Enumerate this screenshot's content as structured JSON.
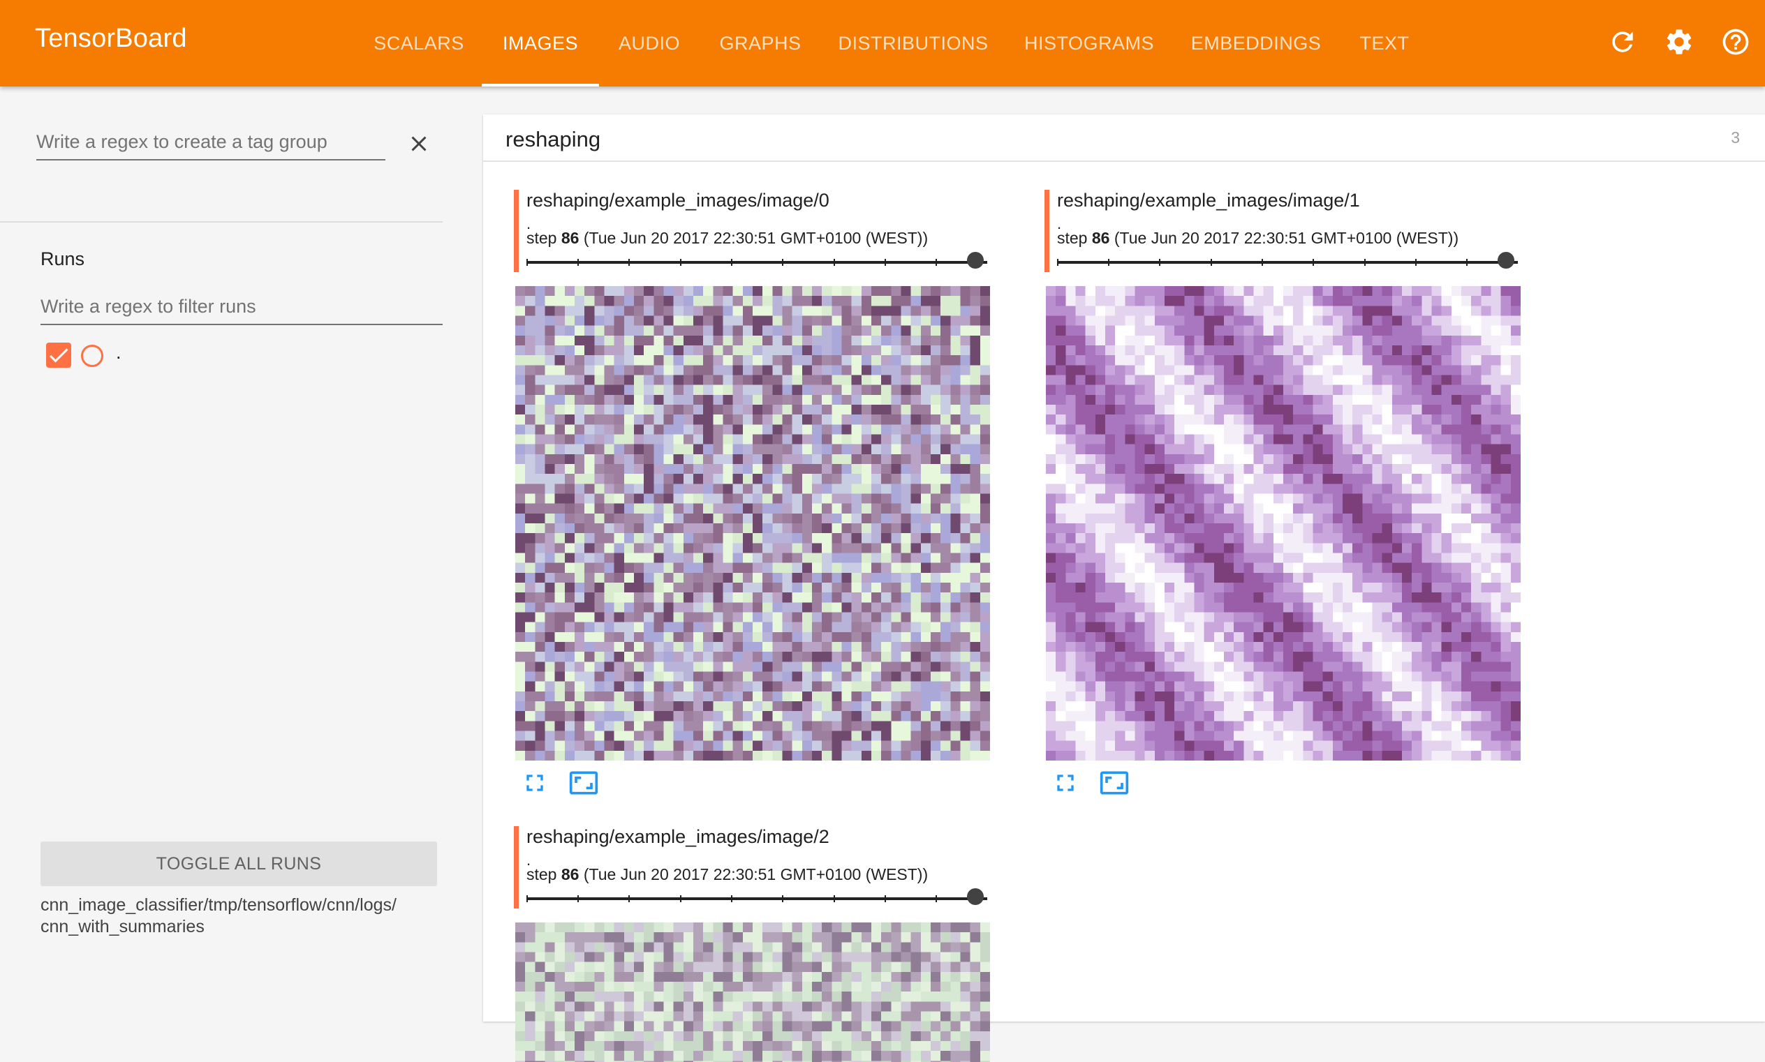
{
  "header": {
    "brand": "TensorBoard",
    "tabs": [
      {
        "label": "SCALARS",
        "active": false
      },
      {
        "label": "IMAGES",
        "active": true
      },
      {
        "label": "AUDIO",
        "active": false
      },
      {
        "label": "GRAPHS",
        "active": false
      },
      {
        "label": "DISTRIBUTIONS",
        "active": false
      },
      {
        "label": "HISTOGRAMS",
        "active": false
      },
      {
        "label": "EMBEDDINGS",
        "active": false
      },
      {
        "label": "TEXT",
        "active": false
      }
    ],
    "icons": [
      "refresh-icon",
      "settings-icon",
      "help-icon"
    ]
  },
  "sidebar": {
    "tag_group_placeholder": "Write a regex to create a tag group",
    "runs_title": "Runs",
    "runs_filter_placeholder": "Write a regex to filter runs",
    "runs": [
      {
        "name": ".",
        "checked": true
      }
    ],
    "toggle_label": "TOGGLE ALL RUNS",
    "logdir_line1": "cnn_image_classifier/tmp/tensorflow/cnn/logs/",
    "logdir_line2": "cnn_with_summaries"
  },
  "main": {
    "group": {
      "title": "reshaping",
      "count": "3"
    },
    "panels": [
      {
        "title": "reshaping/example_images/image/0",
        "run": ".",
        "step_label": "step",
        "step": "86",
        "timestamp": "(Tue Jun 20 2017 22:30:51 GMT+0100 (WEST))"
      },
      {
        "title": "reshaping/example_images/image/1",
        "run": ".",
        "step_label": "step",
        "step": "86",
        "timestamp": "(Tue Jun 20 2017 22:30:51 GMT+0100 (WEST))"
      },
      {
        "title": "reshaping/example_images/image/2",
        "run": ".",
        "step_label": "step",
        "step": "86",
        "timestamp": "(Tue Jun 20 2017 22:30:51 GMT+0100 (WEST))"
      }
    ]
  },
  "colors": {
    "header": "#f57c00",
    "accent": "#ff7043",
    "action_icon": "#2196f3"
  }
}
